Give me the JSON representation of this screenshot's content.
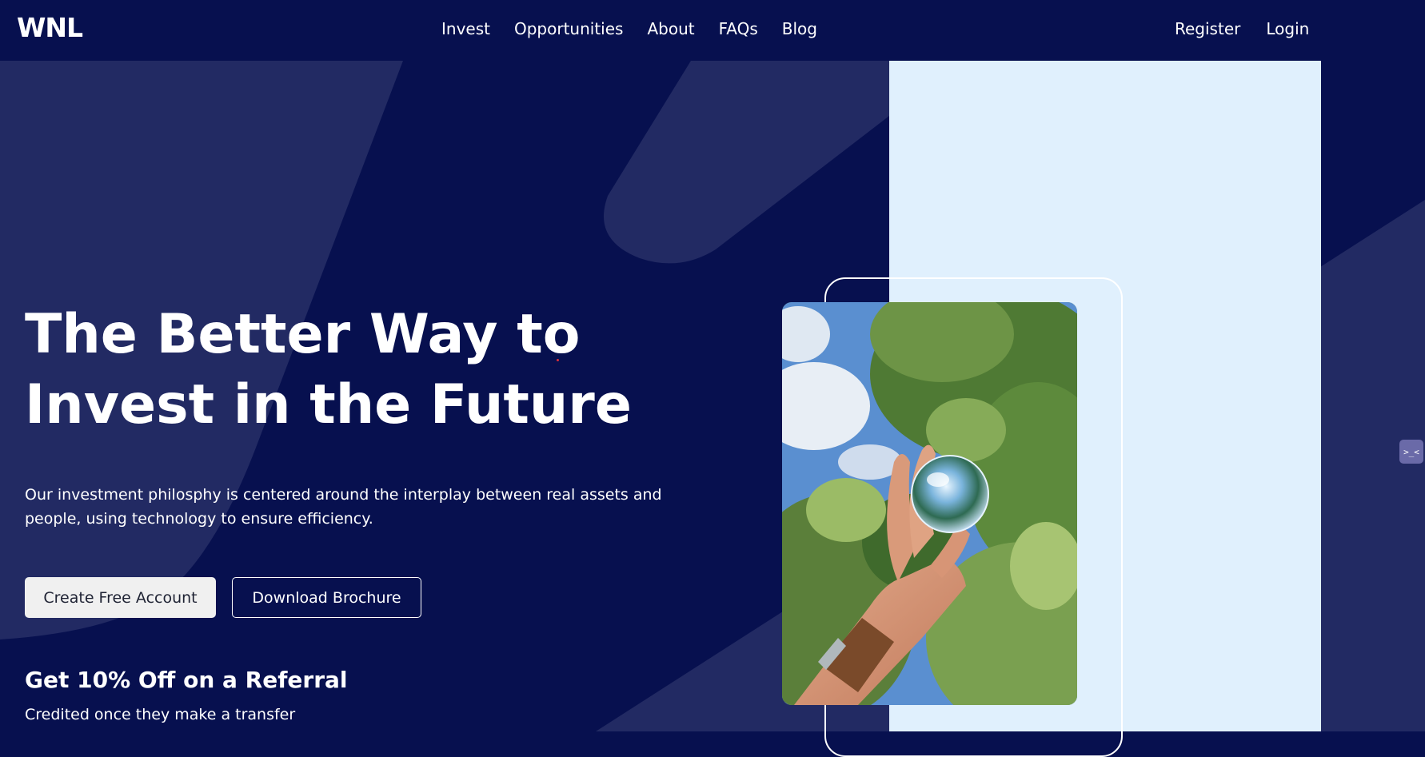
{
  "brand": {
    "logo": "WNL"
  },
  "nav": {
    "items": [
      "Invest",
      "Opportunities",
      "About",
      "FAQs",
      "Blog"
    ],
    "register": "Register",
    "login": "Login"
  },
  "hero": {
    "title_line1": "The Better Way to",
    "title_line2": "Invest in the Future",
    "description": "Our investment philosphy is centered around the interplay between real assets and people, using technology to ensure efficiency.",
    "primary_button": "Create Free Account",
    "secondary_button": "Download Brochure"
  },
  "referral": {
    "title": "Get 10% Off on a Referral",
    "subtitle": "Credited once they make a transfer"
  },
  "side_widget": {
    "icon": ">_<"
  },
  "colors": {
    "background": "#07104f",
    "shape": "#222a63",
    "panel": "#e0f0fd",
    "button_primary_bg": "#f0f0f0"
  }
}
